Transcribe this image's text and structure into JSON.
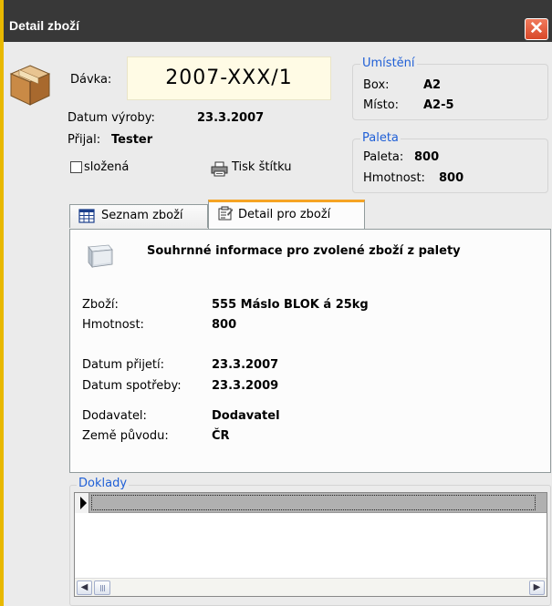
{
  "window": {
    "title": "Detail zboží",
    "close_glyph": "✕"
  },
  "header": {
    "batch_label": "Dávka:",
    "batch_value": "2007-XXX/1",
    "production_date_label": "Datum výroby:",
    "production_date_value": "23.3.2007",
    "received_by_label": "Přijal:",
    "received_by_value": "Tester",
    "folded_label": "složená",
    "folded_checked": false,
    "print_label_button": "Tisk štítku"
  },
  "location": {
    "title": "Umístění",
    "box_label": "Box:",
    "box_value": "A2",
    "place_label": "Místo:",
    "place_value": "A2-5"
  },
  "pallet": {
    "title": "Paleta",
    "pallet_label": "Paleta:",
    "pallet_value": "800",
    "weight_label": "Hmotnost:",
    "weight_value": "800"
  },
  "tabs": [
    {
      "label": "Seznam zboží",
      "active": false
    },
    {
      "label": "Detail pro zboží",
      "active": true
    }
  ],
  "detail": {
    "heading": "Souhrnné informace pro zvolené zboží z palety",
    "goods_label": "Zboží:",
    "goods_value": "555 Máslo BLOK á 25kg",
    "weight_label": "Hmotnost:",
    "weight_value": "800",
    "received_label": "Datum přijetí:",
    "received_value": "23.3.2007",
    "expiry_label": "Datum spotřeby:",
    "expiry_value": "23.3.2009",
    "supplier_label": "Dodavatel:",
    "supplier_value": "Dodavatel",
    "origin_label": "Země původu:",
    "origin_value": "ČR"
  },
  "documents": {
    "title": "Doklady"
  },
  "colors": {
    "titlebar": "#383838",
    "window_frame": "#e8b800",
    "group_title": "#1f5fd6",
    "active_tab_accent": "#f5a424",
    "close_button": "#d84828",
    "panel_bg": "#ebebeb"
  },
  "icons": {
    "window": "box-icon",
    "print": "printer-icon",
    "list_tab": "table-icon",
    "detail_tab": "properties-icon",
    "detail_heading": "cube-icon"
  }
}
